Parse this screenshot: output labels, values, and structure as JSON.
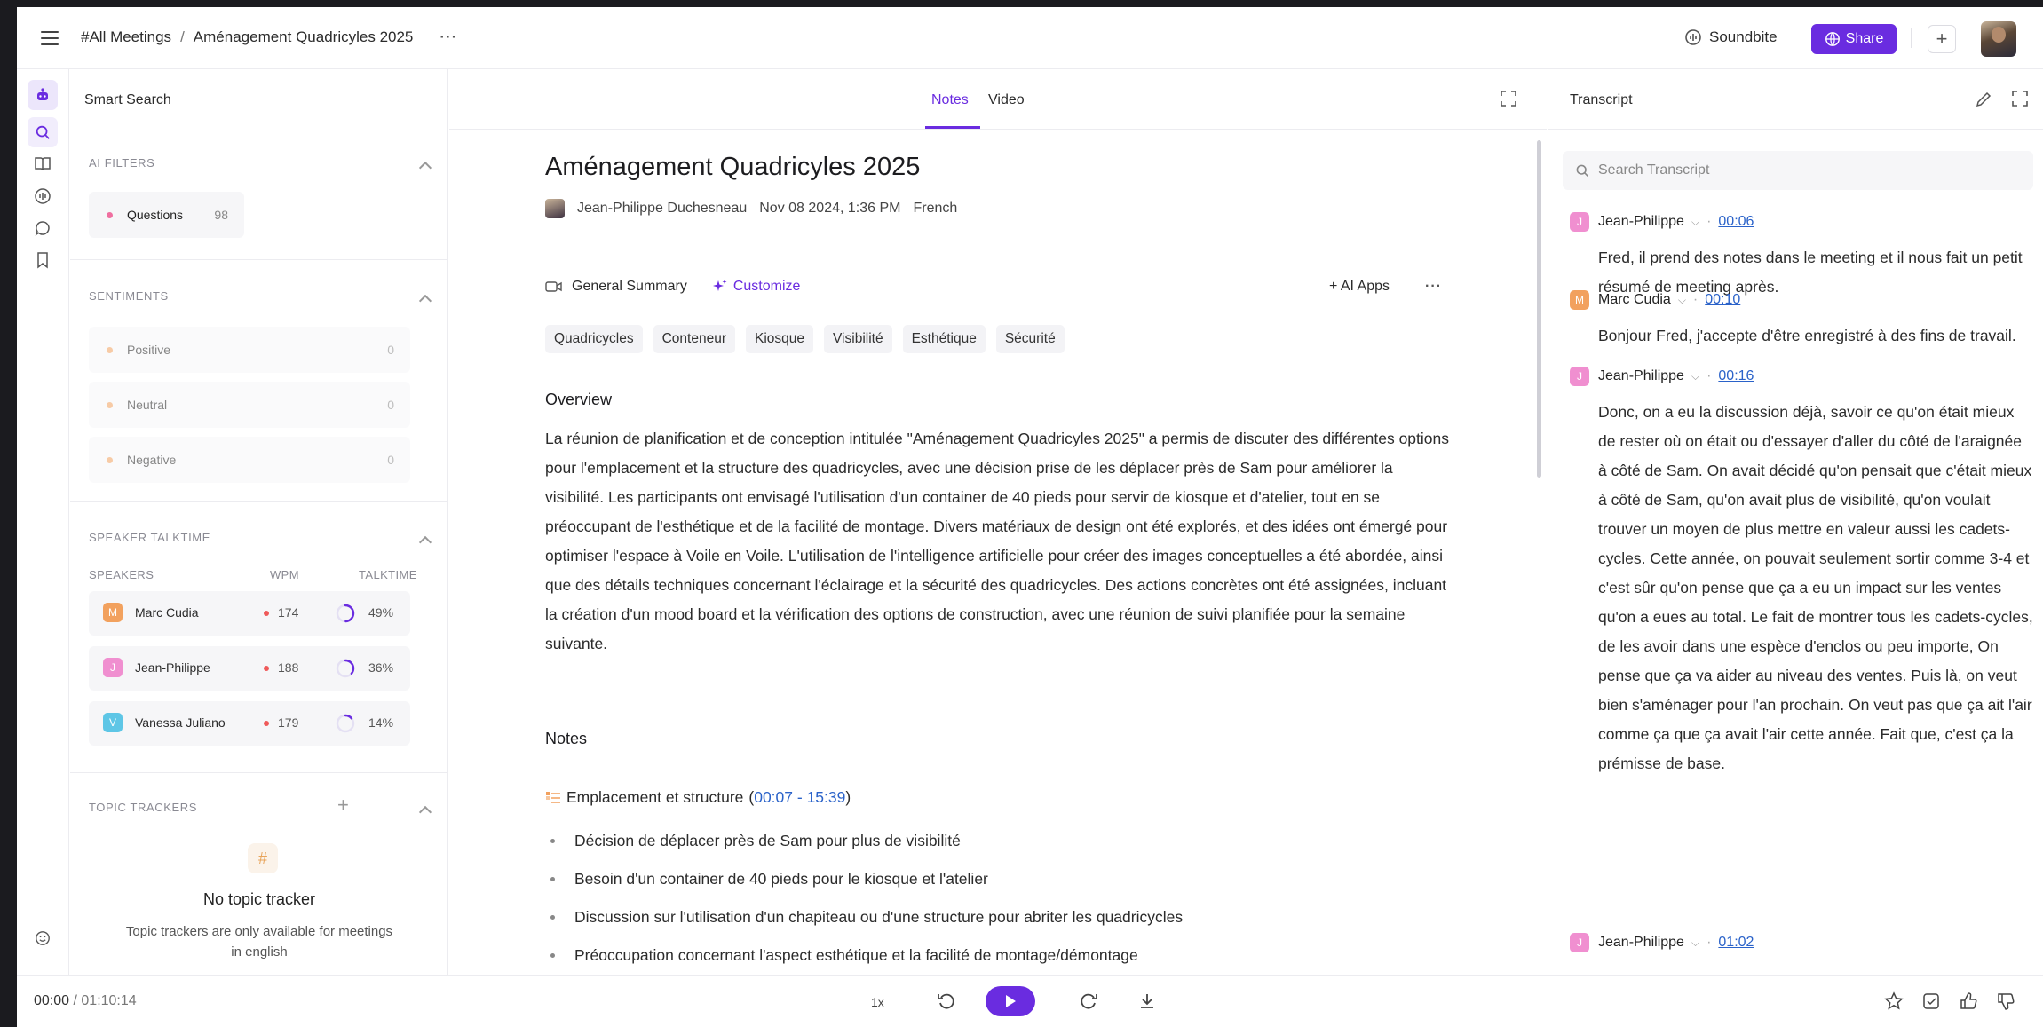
{
  "topbar": {
    "breadcrumb_root": "#All Meetings",
    "breadcrumb_sep": "/",
    "breadcrumb_current": "Aménagement Quadricyles 2025",
    "more": "···",
    "soundbite_label": "Soundbite",
    "share_label": "Share",
    "plus": "+"
  },
  "leftpanel": {
    "title": "Smart Search",
    "ai_filters": {
      "heading": "AI FILTERS",
      "items": [
        {
          "label": "Questions",
          "count": "98",
          "color": "#ef6fa0"
        }
      ]
    },
    "sentiments": {
      "heading": "SENTIMENTS",
      "items": [
        {
          "label": "Positive",
          "count": "0",
          "color": "#f2a15e"
        },
        {
          "label": "Neutral",
          "count": "0",
          "color": "#f2a15e"
        },
        {
          "label": "Negative",
          "count": "0",
          "color": "#f2a15e"
        }
      ]
    },
    "talktime": {
      "heading": "SPEAKER TALKTIME",
      "col_speakers": "SPEAKERS",
      "col_wpm": "WPM",
      "col_talktime": "TALKTIME",
      "speakers": [
        {
          "initial": "M",
          "name": "Marc Cudia",
          "wpm": "174",
          "pct": "49%",
          "fraction": 0.49,
          "color": "#f2a15e"
        },
        {
          "initial": "J",
          "name": "Jean-Philippe",
          "wpm": "188",
          "pct": "36%",
          "fraction": 0.36,
          "color": "#f08fd0"
        },
        {
          "initial": "V",
          "name": "Vanessa Juliano",
          "wpm": "179",
          "pct": "14%",
          "fraction": 0.14,
          "color": "#5ec6e6"
        }
      ]
    },
    "topic_trackers": {
      "heading": "TOPIC TRACKERS",
      "plus": "+",
      "icon_glyph": "#",
      "empty_title": "No topic tracker",
      "empty_sub": "Topic trackers are only available for meetings in english"
    }
  },
  "center": {
    "tabs": [
      {
        "label": "Notes",
        "active": true
      },
      {
        "label": "Video",
        "active": false
      }
    ],
    "title": "Aménagement Quadricyles 2025",
    "author": "Jean-Philippe Duchesneau",
    "date": "Nov 08 2024, 1:36 PM",
    "language": "French",
    "summary_label": "General Summary",
    "customize_label": "Customize",
    "ai_apps_label": "+ AI Apps",
    "more": "···",
    "chips": [
      "Quadricycles",
      "Conteneur",
      "Kiosque",
      "Visibilité",
      "Esthétique",
      "Sécurité"
    ],
    "overview_heading": "Overview",
    "overview_text": "La réunion de planification et de conception intitulée \"Aménagement Quadricyles 2025\" a permis de discuter des différentes options pour l'emplacement et la structure des quadricycles, avec une décision prise de les déplacer près de Sam pour améliorer la visibilité. Les participants ont envisagé l'utilisation d'un container de 40 pieds pour servir de kiosque et d'atelier, tout en se préoccupant de l'esthétique et de la facilité de montage. Divers matériaux de design ont été explorés, et des idées ont émergé pour optimiser l'espace à Voile en Voile. L'utilisation de l'intelligence artificielle pour créer des images conceptuelles a été abordée, ainsi que des détails techniques concernant l'éclairage et la sécurité des quadricycles. Des actions concrètes ont été assignées, incluant la création d'un mood board et la vérification des options de construction, avec une réunion de suivi planifiée pour la semaine suivante.",
    "notes_heading": "Notes",
    "section_title": "Emplacement et structure",
    "section_open": "(",
    "section_time": "00:07 - 15:39",
    "section_close": ")",
    "bullets": [
      "Décision de déplacer près de Sam pour plus de visibilité",
      "Besoin d'un container de 40 pieds pour le kiosque et l'atelier",
      "Discussion sur l'utilisation d'un chapiteau ou d'une structure pour abriter les quadricycles",
      "Préoccupation concernant l'aspect esthétique et la facilité de montage/démontage"
    ]
  },
  "transcript": {
    "title": "Transcript",
    "search_placeholder": "Search Transcript",
    "entries": [
      {
        "initial": "J",
        "speaker": "Jean-Philippe",
        "time": "00:06",
        "color": "#f08fd0",
        "text": "Fred, il prend des notes dans le meeting et il nous fait un petit résumé de meeting après."
      },
      {
        "initial": "M",
        "speaker": "Marc Cudia",
        "time": "00:10",
        "color": "#f2a15e",
        "text": "Bonjour Fred, j'accepte d'être enregistré à des fins de travail."
      },
      {
        "initial": "J",
        "speaker": "Jean-Philippe",
        "time": "00:16",
        "color": "#f08fd0",
        "text": "Donc, on a eu la discussion déjà, savoir ce qu'on était mieux de rester où on était ou d'essayer d'aller du côté de l'araignée à côté de Sam. On avait décidé qu'on pensait que c'était mieux à côté de Sam, qu'on avait plus de visibilité, qu'on voulait trouver un moyen de plus mettre en valeur aussi les cadets-cycles. Cette année, on pouvait seulement sortir comme 3-4 et c'est sûr qu'on pense que ça a eu un impact sur les ventes qu'on a eues au total. Le fait de montrer tous les cadets-cycles, de les avoir dans une espèce d'enclos ou peu importe, On pense que ça va aider au niveau des ventes. Puis là, on veut bien s'aménager pour l'an prochain. On veut pas que ça ait l'air comme ça que ça avait l'air cette année. Fait que, c'est ça la prémisse de base."
      },
      {
        "initial": "J",
        "speaker": "Jean-Philippe",
        "time": "01:02",
        "color": "#f08fd0",
        "text": ""
      }
    ]
  },
  "player": {
    "current": "00:00",
    "sep": " / ",
    "total": "01:10:14",
    "speed": "1x"
  },
  "colors": {
    "accent": "#6a2ce0",
    "link": "#2a62c9"
  }
}
